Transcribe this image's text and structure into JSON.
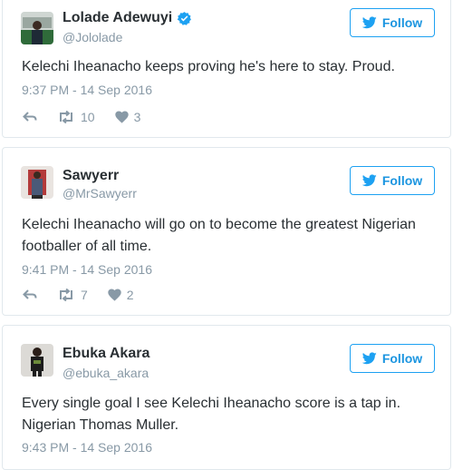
{
  "follow_label": "Follow",
  "tweets": [
    {
      "name": "Lolade Adewuyi",
      "verified": true,
      "handle": "@Jololade",
      "text": "Kelechi Iheanacho keeps proving he's here to stay. Proud.",
      "time": "9:37 PM - 14 Sep 2016",
      "retweets": "10",
      "likes": "3"
    },
    {
      "name": "Sawyerr",
      "verified": false,
      "handle": "@MrSawyerr",
      "text": "Kelechi Iheanacho will go on to become the greatest Nigerian footballer of all time.",
      "time": "9:41 PM - 14 Sep 2016",
      "retweets": "7",
      "likes": "2"
    },
    {
      "name": "Ebuka Akara",
      "verified": false,
      "handle": "@ebuka_akara",
      "text": "Every single goal I see Kelechi Iheanacho score is a tap in. Nigerian Thomas Muller.",
      "time": "9:43 PM - 14 Sep 2016"
    }
  ],
  "colors": {
    "accent": "#1da1f2",
    "text": "#292f33",
    "muted": "#8899a6",
    "border": "#e1e8ed"
  },
  "icons": [
    "bird-icon",
    "verified-icon",
    "reply-icon",
    "retweet-icon",
    "heart-icon"
  ]
}
